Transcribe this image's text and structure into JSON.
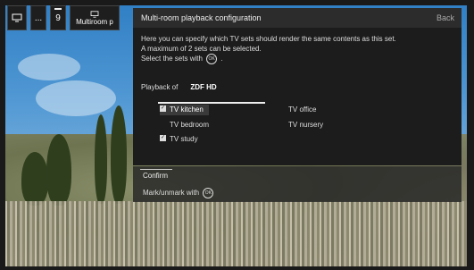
{
  "topbar": {
    "tiles": [
      {
        "icon": "tv-icon"
      },
      {
        "label": "..."
      },
      {
        "label": "9"
      },
      {
        "label": "Multiroom p",
        "icon": "tv-icon"
      }
    ]
  },
  "dialog": {
    "title": "Multi-room playback configuration",
    "back": "Back",
    "desc_line1": "Here you can specify which TV sets should render the same contents as this set.",
    "desc_line2": "A maximum of 2 sets can be selected.",
    "desc_line3": "Select the sets with",
    "desc_line3_tail": ".",
    "ok_symbol": "OK",
    "playback_label": "Playback of",
    "playback_channel": "ZDF HD",
    "tv_sets": [
      {
        "label": "TV kitchen",
        "checked": true,
        "selected": true
      },
      {
        "label": "TV office",
        "checked": false,
        "selected": false
      },
      {
        "label": "TV bedroom",
        "checked": false,
        "selected": false
      },
      {
        "label": "TV nursery",
        "checked": false,
        "selected": false
      },
      {
        "label": "TV study",
        "checked": true,
        "selected": false
      }
    ]
  },
  "footer": {
    "confirm": "Confirm",
    "mark": "Mark/unmark with",
    "ok_symbol": "OK"
  },
  "colors": {
    "panel_bg": "#1c1c1c",
    "header_bg": "#2c2c2c",
    "text": "#eeeeee"
  }
}
